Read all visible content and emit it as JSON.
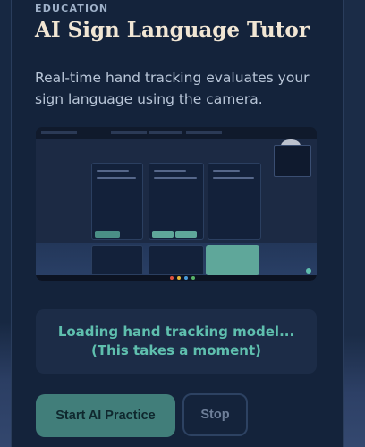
{
  "card": {
    "eyebrow": "EDUCATION",
    "title": "AI Sign Language Tutor",
    "description": "Real-time hand tracking evaluates your sign language using the camera."
  },
  "status": {
    "message": "Loading hand tracking model... (This takes a moment)"
  },
  "actions": {
    "start_label": "Start AI Practice",
    "stop_label": "Stop"
  },
  "colors": {
    "accent": "#5fbfae",
    "primary_button": "#4a8f86",
    "title": "#f1e6d4"
  }
}
